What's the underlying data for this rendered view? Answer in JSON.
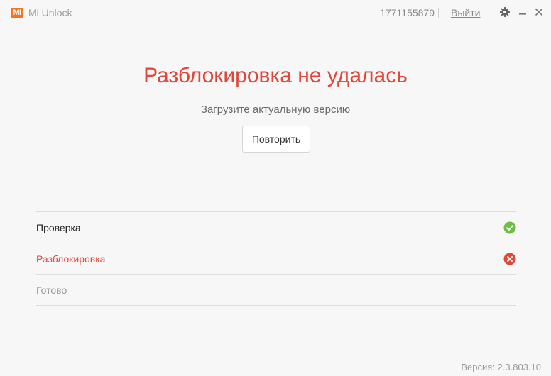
{
  "app": {
    "logo_text": "MI",
    "title": "Mi Unlock"
  },
  "header": {
    "account_id": "1771155879",
    "logout_label": "Выйти",
    "icons": [
      "gear-icon",
      "minimize-icon",
      "close-icon"
    ]
  },
  "main": {
    "headline": "Разблокировка не удалась",
    "subtitle": "Загрузите актуальную версию",
    "retry_label": "Повторить"
  },
  "steps": [
    {
      "label": "Проверка",
      "status": "done",
      "icon": "check-circle-icon"
    },
    {
      "label": "Разблокировка",
      "status": "failed",
      "icon": "error-circle-icon"
    },
    {
      "label": "Готово",
      "status": "pending",
      "icon": ""
    }
  ],
  "footer": {
    "version": "Версия: 2.3.803.10"
  },
  "colors": {
    "accent_orange": "#f5731f",
    "error_red": "#e2463a",
    "success_green": "#6cbe45",
    "background": "#f7f7f7"
  }
}
